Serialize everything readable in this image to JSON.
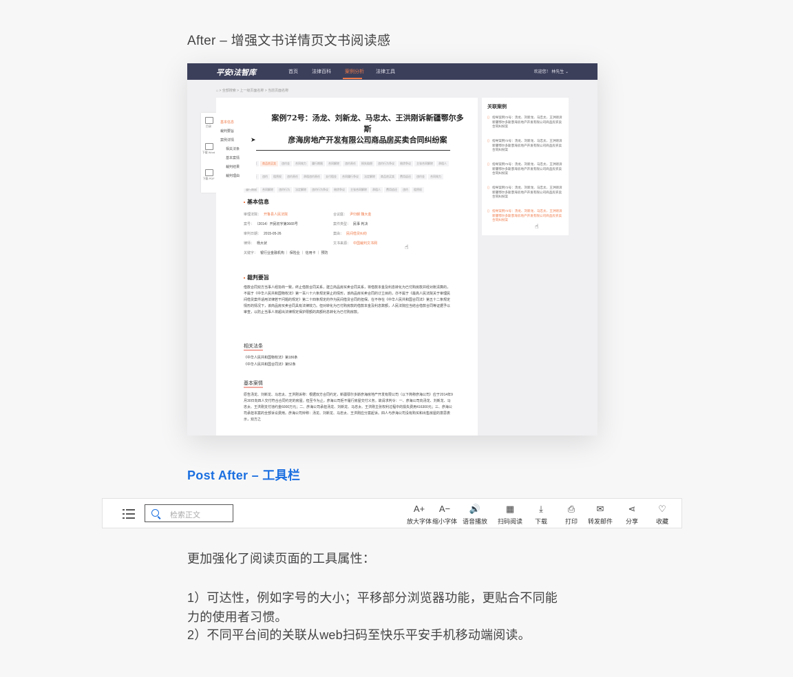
{
  "section1": {
    "heading": "After – 增强文书详情页文书阅读感"
  },
  "screenshot": {
    "logo": "平安i法智库",
    "nav": [
      "首页",
      "法律百科",
      "案例分析",
      "法律工具"
    ],
    "welcome": "欢迎您！ 林先生 ⌄",
    "breadcrumb": "⌂ > 全部搜索 > 上一级页面名称 > 当前页面名称",
    "tools": [
      "目录",
      "下载 Word",
      "下载 PDF"
    ],
    "toc": [
      "基本信息",
      "裁判要旨",
      "案例详情",
      "相关法条",
      "基本案情",
      "裁判结果",
      "裁判理由"
    ],
    "doc_title": "指导案例72号：汤龙、刘新龙、马忠太、王洪刚诉新疆鄂尔多斯彦海房地产开发有限公司商品房买卖合同纠纷案",
    "doc_title_line1": "案例72号：汤龙、刘新龙、马忠太、王洪刚诉新疆鄂尔多斯",
    "doc_title_line2": "彦海房地产开发有限公司商品房买卖合同纠纷案",
    "doc_sub": "最高人民法院 ｜（2015）民一终字第180号",
    "tags": [
      "买卖合同",
      "商品房买卖",
      "违约金",
      "合同效力",
      "履行期限",
      "合同解除",
      "违约责任",
      "损失赔偿",
      "违约行为争议",
      "借贷争议",
      "主张合同解除",
      "承租人",
      "费用追还",
      "违约",
      "租赁权",
      "违约责任",
      "承租违约责任",
      "支付租金",
      "合同履行争议",
      "法定解除",
      "商品房买卖",
      "费用返还",
      "违约金",
      "合同效力",
      "履行期限",
      "合同解除",
      "违约行为",
      "法定解除",
      "违约行为争议",
      "借贷争议",
      "主张合同解除",
      "承租人",
      "费用追还",
      "违约",
      "租赁权"
    ],
    "basic_info_heading": "基本信息",
    "basic_info": [
      {
        "k": "审理法院：",
        "v": "开鲁县人民法院",
        "o": true
      },
      {
        "k": "合议庭：",
        "v": "尹归朝 魏大金",
        "o": true
      },
      {
        "k": "案号：",
        "v": "（2014）开民初字第3665号"
      },
      {
        "k": "案件类型：",
        "v": "民事 判决"
      },
      {
        "k": "审判日期：",
        "v": "2015-05-26"
      },
      {
        "k": "案由：",
        "v": "民间借贷纠纷",
        "o": true
      },
      {
        "k": "律师：",
        "v": "杨大状"
      },
      {
        "k": "文书来源：",
        "v": "中国裁判文书网",
        "o": true
      },
      {
        "k": "关键字：",
        "v": "银行业金融机构 ｜ 保险业 ｜ 信用卡 ｜ 预防"
      }
    ],
    "ruling_heading": "裁判要旨",
    "ruling_text": "借款合同双方当事人经协商一致，终止借款合同关系，建立商品房买卖合同关系，将借款本金及利息转化为已付购房款并经对账清算的，不属于《中华人民共和国物权法》第一百八十六条规定禁止的情形，该商品房买卖合同的订立目的，亦不属于《最高人民法院关于审理民间借贷案件适用法律若干问题的规定》第二十四条规定的作为民间借贷合同的担保。在不存在《中华人民共和国合同法》第五十二条规定情形的情况下，该商品房买卖合同具有法律效力。但对转化为已付购房款的借款本金及利息数额，人民法院应当结合借款合同等证据予以审查，以防止当事人将超出法律规定保护限额的高额利息转化为已付购房款。",
    "law_heading": "相关法条",
    "laws": [
      "《中华人民共和国物权法》第186条",
      "《中华人民共和国合同法》第52条"
    ],
    "case_heading": "基本案情",
    "case_text": "原告汤龙、刘新龙、马忠太、王洪刚诉称：根据双方合同约定，新疆鄂尔多斯彦海房地产开发有限公司（以下简称彦海公司）应于2014年9月30日向四人交付符合合同约定的房屋。但至今为止，彦海公司拒不履行房屋交付义务。故请求判令：一、彦海公司向汤龙、刘新龙、马忠太、王洪刚支付违约金6000万元；二、彦海公司承担汤龙、刘新龙、马忠太、王洪刚主张权利过程中的损失费用416300元；三、彦海公司承担本案的全部诉讼费用。彦海公司辩称：汤龙、刘新龙、马忠太、王洪刚应分案起诉。四人与彦海公司没有购买和出售房屋的意思表示，双方之",
    "related_heading": "关联案例",
    "related": [
      "指导案例72号：汤龙、刘新龙、马忠太、王洪刚诉新疆鄂尔多斯彦海房地产开发有限公司商品房买卖合同纠纷案",
      "指导案例72号：汤龙、刘新龙、马忠太、王洪刚诉新疆鄂尔多斯彦海房地产开发有限公司商品房买卖合同纠纷案",
      "指导案例72号：汤龙、刘新龙、马忠太、王洪刚诉新疆鄂尔多斯彦海房地产开发有限公司商品房买卖合同纠纷案",
      "指导案例72号：汤龙、刘新龙、马忠太、王洪刚诉新疆鄂尔多斯彦海房地产开发有限公司商品房买卖合同纠纷案",
      "指导案例72号：汤龙、刘新龙、马忠太、王洪刚诉新疆鄂尔多斯彦海房地产开发有限公司商品房买卖合同纠纷案"
    ]
  },
  "section2": {
    "heading": "Post After – 工具栏"
  },
  "toolbar": {
    "search_placeholder": "检索正文",
    "buttons": [
      {
        "icon": "font-increase-icon",
        "glyph": "A+",
        "label": "放大字体"
      },
      {
        "icon": "font-decrease-icon",
        "glyph": "A−",
        "label": "缩小字体"
      },
      {
        "icon": "speaker-icon",
        "glyph": "🔊",
        "label": "语音播放"
      },
      {
        "icon": "qrcode-icon",
        "glyph": "▦",
        "label": "扫码阅读"
      },
      {
        "icon": "download-icon",
        "glyph": "⤓",
        "label": "下载"
      },
      {
        "icon": "printer-icon",
        "glyph": "⎙",
        "label": "打印"
      },
      {
        "icon": "mail-icon",
        "glyph": "✉",
        "label": "转发邮件"
      },
      {
        "icon": "share-icon",
        "glyph": "⋖",
        "label": "分享"
      },
      {
        "icon": "heart-icon",
        "glyph": "♡",
        "label": "收藏"
      }
    ]
  },
  "description": {
    "intro": "更加强化了阅读页面的工具属性：",
    "point1_line1": "1）可达性，例如字号的大小；平移部分浏览器功能，更贴合不同能",
    "point1_line2": "力的使用者习惯。",
    "point2": "2）不同平台间的关联从web扫码至快乐平安手机移动端阅读。"
  },
  "colors": {
    "accent": "#f07c4c",
    "navbar": "#3c3f5a",
    "link_blue": "#1b6fe0"
  }
}
